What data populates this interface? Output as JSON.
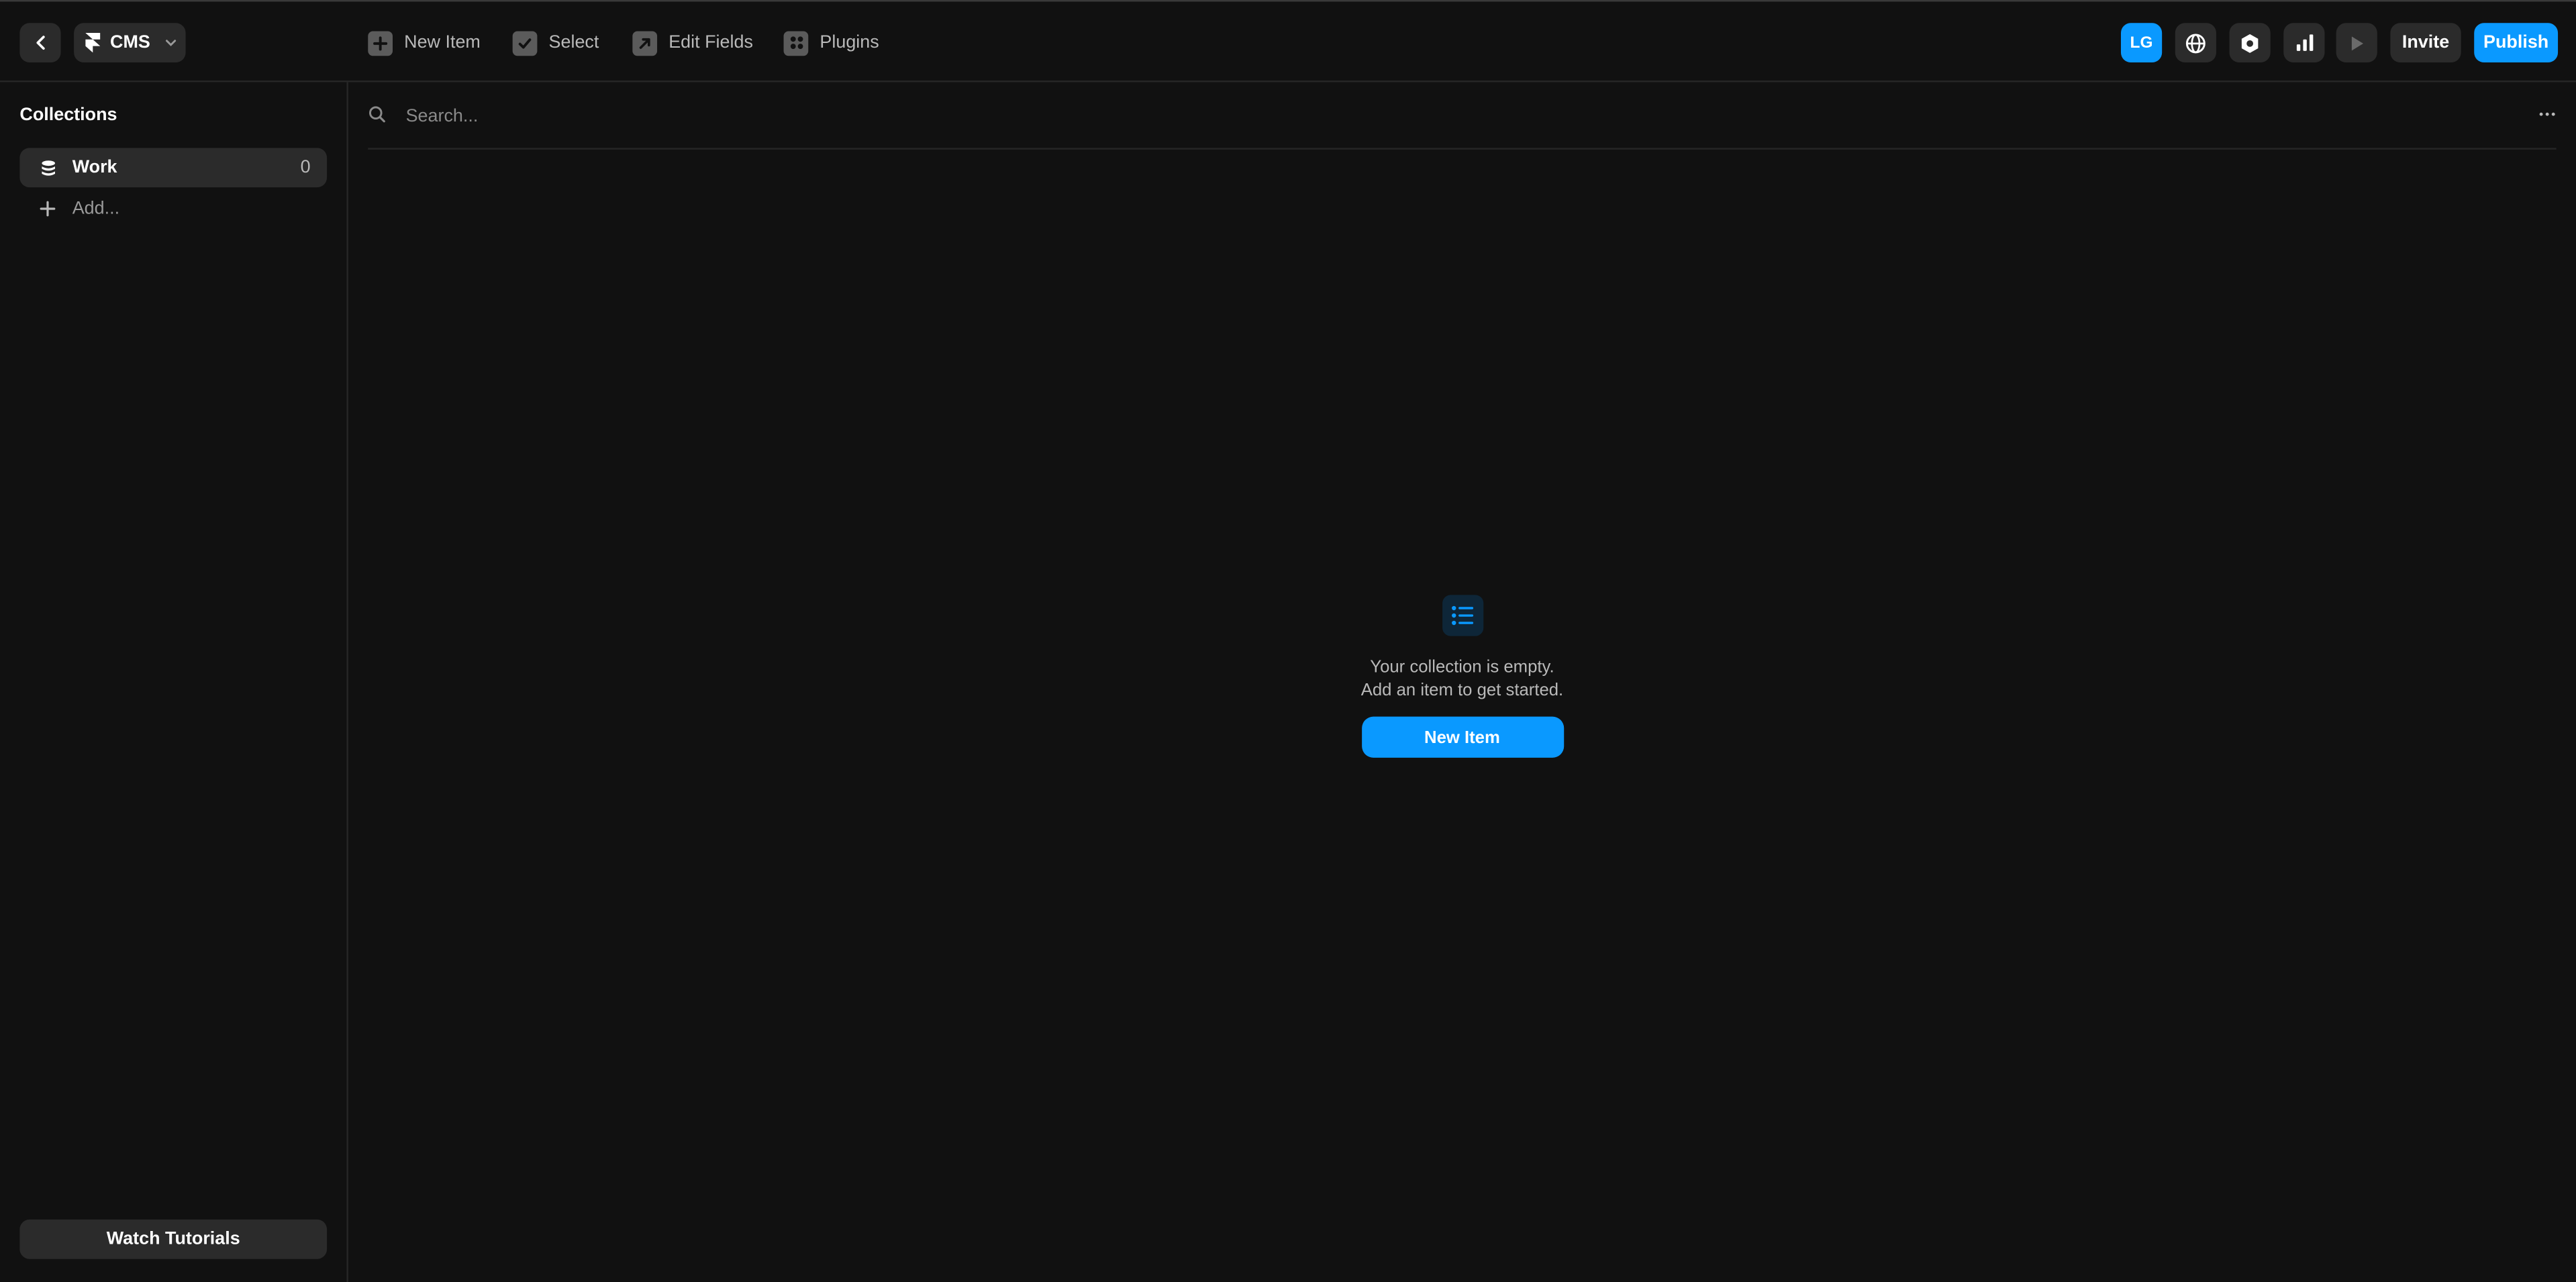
{
  "header": {
    "app_name": "CMS",
    "toolbar": {
      "new_item": "New Item",
      "select": "Select",
      "edit_fields": "Edit Fields",
      "plugins": "Plugins"
    },
    "avatar_initials": "LG",
    "invite_label": "Invite",
    "publish_label": "Publish"
  },
  "sidebar": {
    "title": "Collections",
    "collections": [
      {
        "name": "Work",
        "count": "0",
        "icon": "database-icon"
      }
    ],
    "add_label": "Add...",
    "watch_tutorials_label": "Watch Tutorials"
  },
  "main": {
    "search": {
      "placeholder": "Search...",
      "value": ""
    },
    "empty_state": {
      "line1": "Your collection is empty.",
      "line2": "Add an item to get started.",
      "button_label": "New Item",
      "icon": "list-icon"
    }
  },
  "colors": {
    "background": "#111111",
    "surface": "#2b2b2b",
    "accent": "#0a99ff",
    "muted_text": "#b9b9b9",
    "divider": "#262626"
  }
}
